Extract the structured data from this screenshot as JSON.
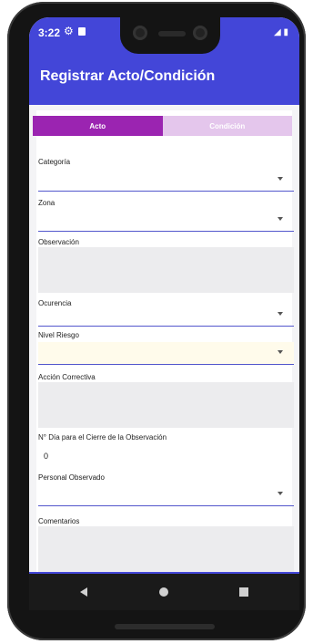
{
  "status": {
    "time": "3:22",
    "gear_icon": "⚙",
    "signal_battery": "◢ ▮"
  },
  "appbar": {
    "title": "Registrar Acto/Condición"
  },
  "tabs": [
    {
      "label": "Acto",
      "active": true
    },
    {
      "label": "Condición",
      "active": false
    }
  ],
  "form": {
    "categoria": {
      "label": "Categoría",
      "value": ""
    },
    "zona": {
      "label": "Zona",
      "value": ""
    },
    "observacion": {
      "label": "Observación",
      "value": ""
    },
    "ocurencia": {
      "label": "Ocurencia",
      "value": ""
    },
    "nivel_riesgo": {
      "label": "Nivel Riesgo",
      "value": ""
    },
    "accion_correctiva": {
      "label": "Acción Correctiva",
      "value": ""
    },
    "dias_cierre": {
      "label": "N° Día para el Cierre de la Observación",
      "value": "0"
    },
    "personal_observado": {
      "label": "Personal Observado",
      "value": ""
    },
    "comentarios": {
      "label": "Comentarios",
      "value": ""
    }
  },
  "colors": {
    "primary": "#4346d8",
    "tab_active": "#9b24b1",
    "tab_inactive": "#e4c6ec"
  }
}
